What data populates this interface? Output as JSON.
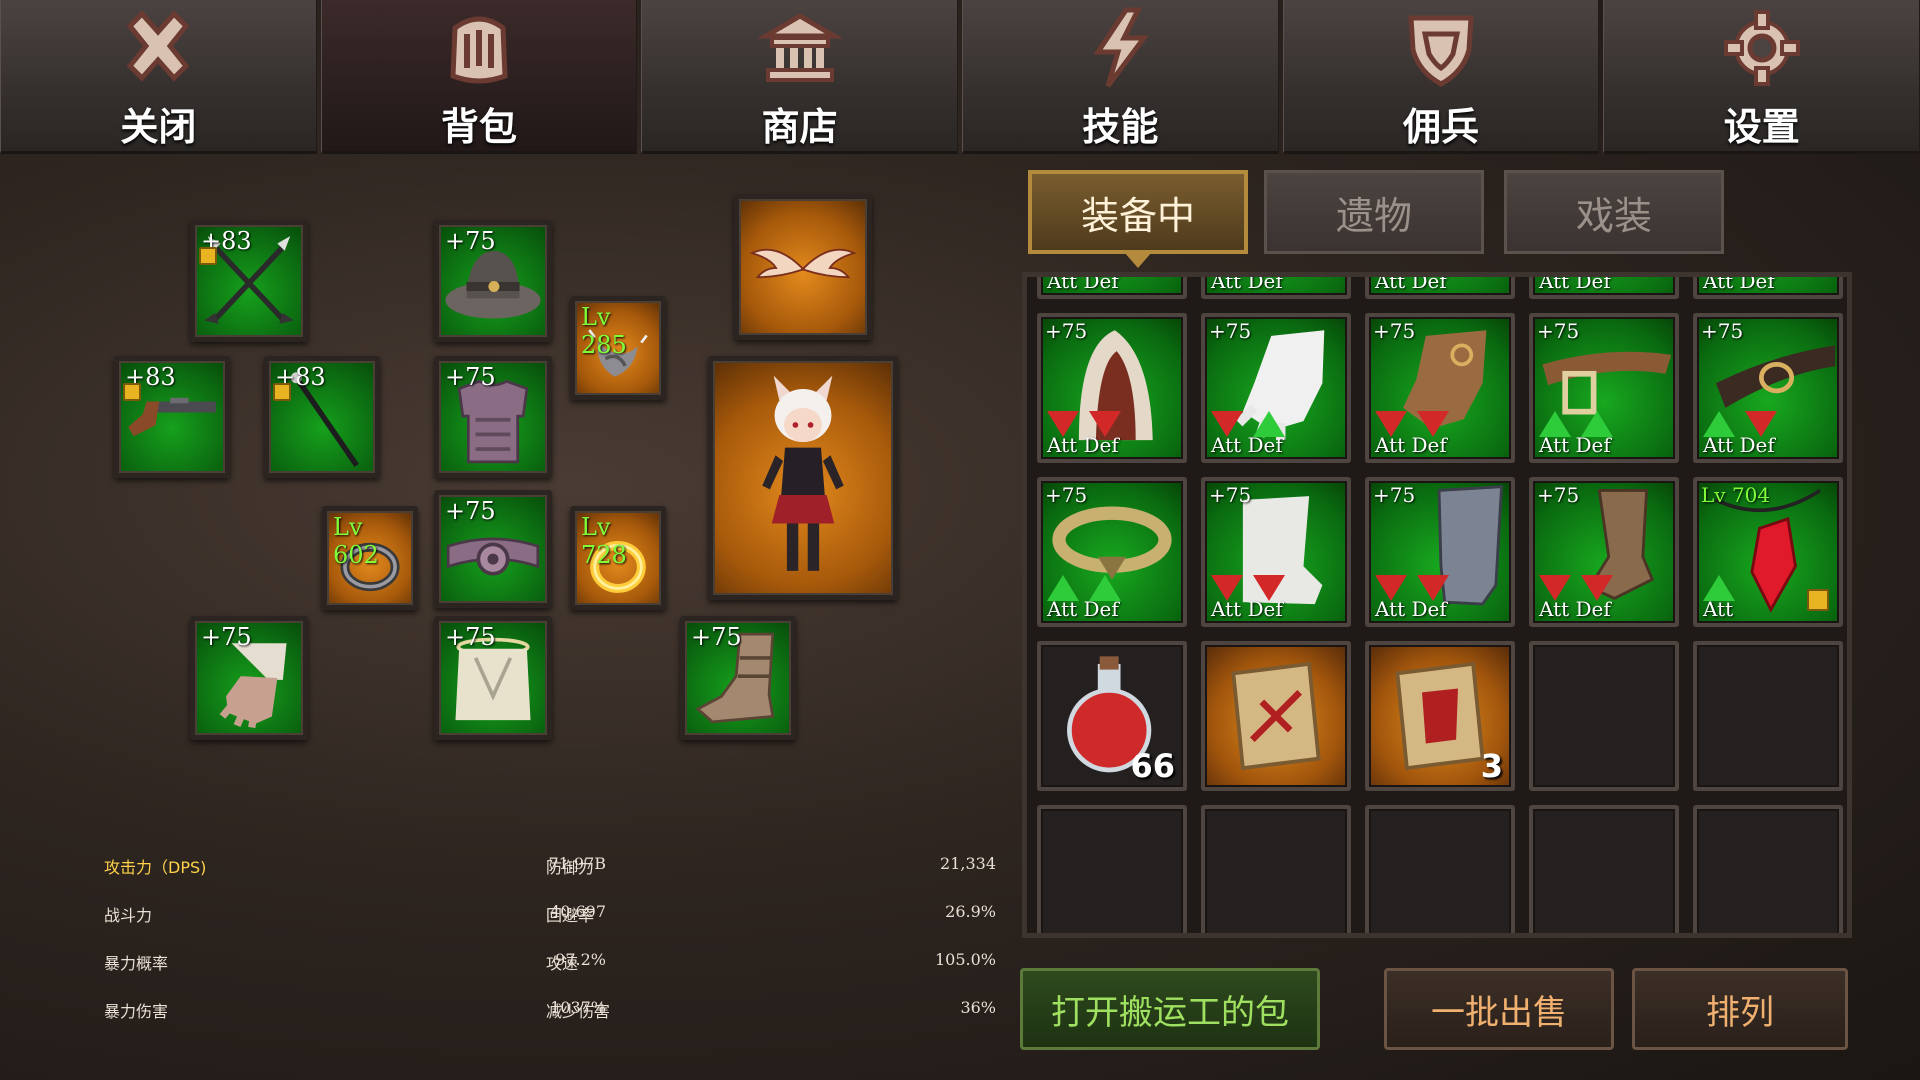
{
  "nav": {
    "items": [
      {
        "label": "关闭",
        "icon": "close-icon"
      },
      {
        "label": "背包",
        "icon": "backpack-icon"
      },
      {
        "label": "商店",
        "icon": "shop-icon"
      },
      {
        "label": "技能",
        "icon": "skill-icon"
      },
      {
        "label": "佣兵",
        "icon": "mercenary-shield-icon"
      },
      {
        "label": "设置",
        "icon": "gear-icon"
      }
    ],
    "active": "背包"
  },
  "equipment": {
    "crossed_spears": "+83",
    "hat": "+75",
    "amulet": "Lv 285",
    "wings": "",
    "pistol": "+83",
    "staff": "+83",
    "armor": "+75",
    "ring_left": "Lv 602",
    "belt": "+75",
    "ring_right": "Lv 728",
    "gloves": "+75",
    "pants": "+75",
    "boots": "+75"
  },
  "stats": {
    "left": [
      {
        "label": "攻击力（DPS)",
        "value": "71.97B"
      },
      {
        "label": "战斗力",
        "value": "40,697"
      },
      {
        "label": "暴力概率",
        "value": "97.2%"
      },
      {
        "label": "暴力伤害",
        "value": "1037%"
      }
    ],
    "right": [
      {
        "label": "防御力",
        "value": "21,334"
      },
      {
        "label": "回避率",
        "value": "26.9%"
      },
      {
        "label": "攻速",
        "value": "105.0%"
      },
      {
        "label": "减少伤害",
        "value": "36%"
      }
    ],
    "highlight_color": "#ffd24a"
  },
  "inventory": {
    "tabs": [
      "装备中",
      "遗物",
      "戏装"
    ],
    "active_tab": "装备中",
    "partial_row_label": "Att Def",
    "items": [
      {
        "level": "+75",
        "label": "Att Def",
        "att": "down",
        "def": "down",
        "icon": "hood-icon"
      },
      {
        "level": "+75",
        "label": "Att Def",
        "att": "down",
        "def": "up",
        "icon": "white-glove-icon"
      },
      {
        "level": "+75",
        "label": "Att Def",
        "att": "down",
        "def": "down",
        "icon": "leather-glove-icon"
      },
      {
        "level": "+75",
        "label": "Att Def",
        "att": "up",
        "def": "up",
        "icon": "leather-belt-icon"
      },
      {
        "level": "+75",
        "label": "Att Def",
        "att": "up",
        "def": "down",
        "icon": "buckle-belt-icon"
      },
      {
        "level": "+75",
        "label": "Att Def",
        "att": "up",
        "def": "up",
        "icon": "gold-ring-icon"
      },
      {
        "level": "+75",
        "label": "Att Def",
        "att": "down",
        "def": "down",
        "icon": "white-boot-icon"
      },
      {
        "level": "+75",
        "label": "Att Def",
        "att": "down",
        "def": "down",
        "icon": "steel-boot-icon"
      },
      {
        "level": "+75",
        "label": "Att Def",
        "att": "down",
        "def": "down",
        "icon": "brown-boot-icon"
      },
      {
        "level": "Lv 704",
        "label": "Att",
        "att": "up",
        "def": "",
        "icon": "red-gem-necklace-icon"
      }
    ],
    "consumables": [
      {
        "count": "66",
        "icon": "red-potion-icon"
      },
      {
        "count": "",
        "icon": "sword-scroll-icon"
      },
      {
        "count": "3",
        "icon": "armor-scroll-icon"
      }
    ]
  },
  "buttons": {
    "porter": "打开搬运工的包",
    "sell": "一批出售",
    "sort": "排列"
  }
}
